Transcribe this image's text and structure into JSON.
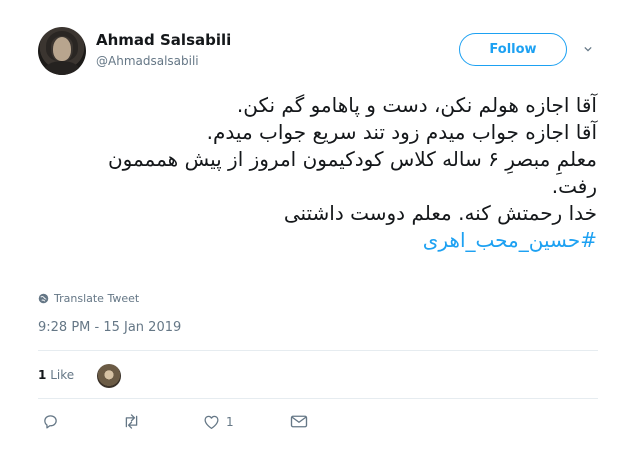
{
  "author": {
    "name": "Ahmad Salsabili",
    "handle": "@Ahmadsalsabili"
  },
  "follow_label": "Follow",
  "tweet": {
    "lines": [
      "آقا اجازه هولم نکن، دست و پاهامو گم نکن.",
      "آقا اجازه جواب میدم زود تند سریع جواب میدم.",
      "معلمِ مبصرِ ۶ ساله کلاس کودکیمون امروز از پیش همممون",
      "رفت.",
      "خدا رحمتش کنه. معلم دوست داشتنی"
    ],
    "hashtag": "#حسین_محب_اهری"
  },
  "translate_label": "Translate Tweet",
  "timestamp": "9:28 PM - 15 Jan 2019",
  "likes": {
    "count": "1",
    "label": "Like"
  },
  "actions": {
    "reply_icon": "reply-icon",
    "retweet_icon": "retweet-icon",
    "like_icon": "heart-icon",
    "like_count": "1",
    "message_icon": "envelope-icon"
  },
  "colors": {
    "accent": "#1da1f2",
    "muted": "#657786",
    "text": "#14171a"
  }
}
